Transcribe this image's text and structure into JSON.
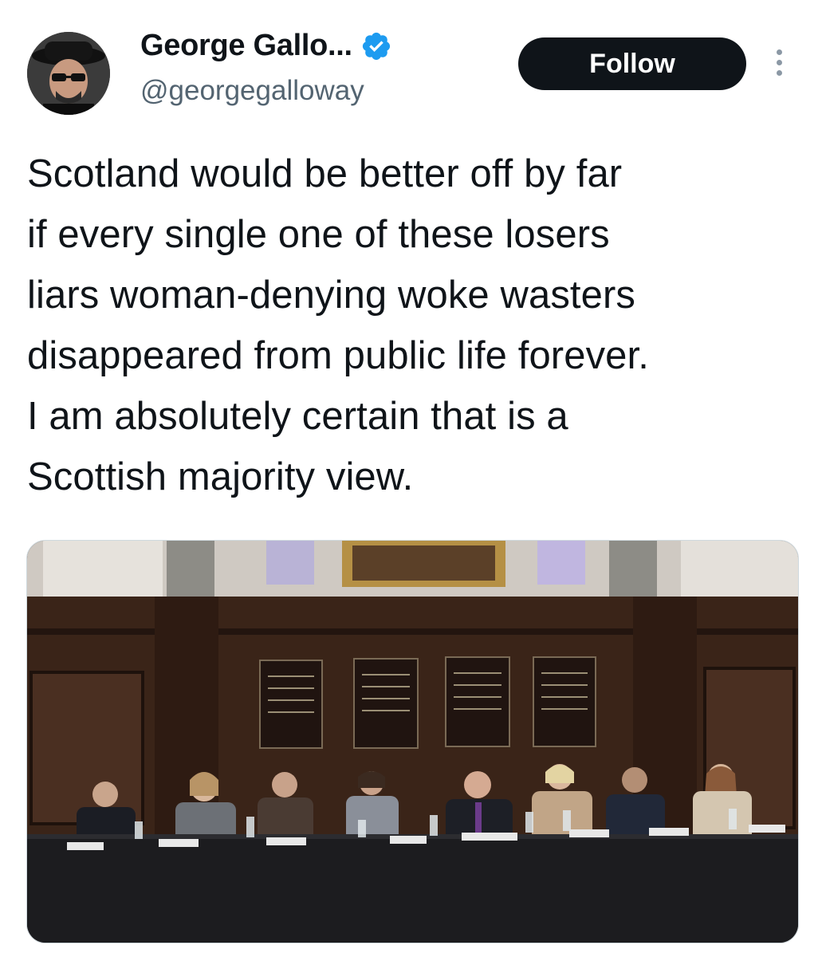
{
  "author": {
    "display_name": "George Gallo...",
    "handle": "@georgegalloway",
    "verified": true,
    "avatar_icon": "profile-photo"
  },
  "actions": {
    "follow_label": "Follow",
    "more_icon": "more-vertical-icon"
  },
  "tweet": {
    "text": "Scotland would be better off by far\nif every single one of these losers\nliars woman-denying woke wasters\ndisappeared from public life forever.\nI am absolutely certain that is a\nScottish majority view."
  },
  "media": {
    "description_icon": "photo-panel-event",
    "colors": {
      "wood": "#3a2418",
      "table": "#1c1c1f",
      "verified": "#1d9bf0",
      "button": "#0f1419"
    }
  }
}
